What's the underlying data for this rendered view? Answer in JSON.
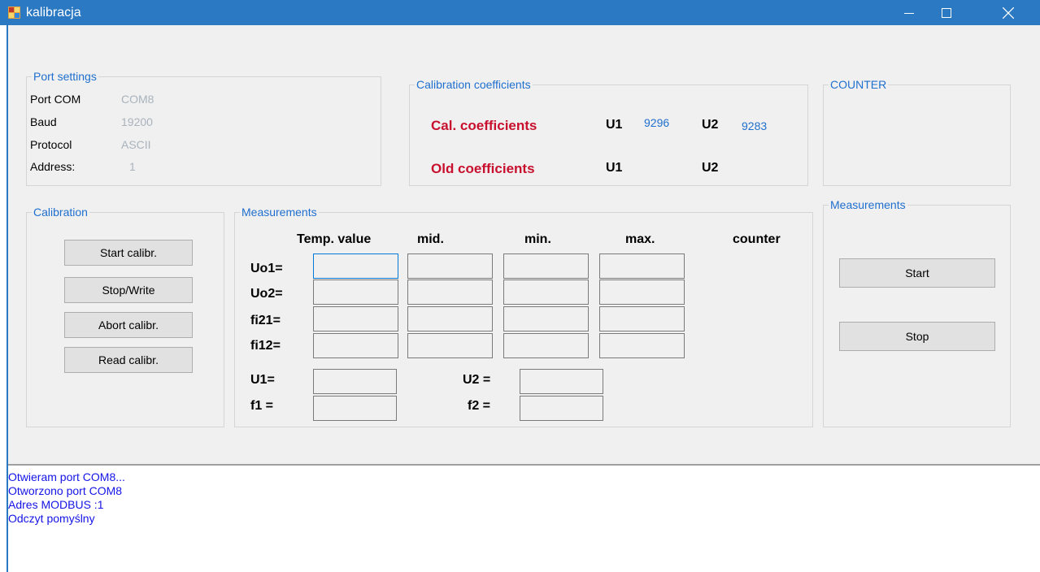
{
  "window": {
    "title": "kalibracja"
  },
  "port_settings": {
    "legend": "Port settings",
    "rows": [
      {
        "label": "Port COM",
        "value": "COM8"
      },
      {
        "label": "Baud",
        "value": "19200"
      },
      {
        "label": "Protocol",
        "value": "ASCII"
      },
      {
        "label": "Address:",
        "value": "1"
      }
    ]
  },
  "calibration_coefficients": {
    "legend": "Calibration coefficients",
    "cal_label": "Cal. coefficients",
    "old_label": "Old coefficients",
    "u1_label": "U1",
    "u2_label": "U2",
    "cal_u1_value": "9296",
    "cal_u2_value": "9283"
  },
  "counter_group": {
    "legend": "COUNTER"
  },
  "calibration": {
    "legend": "Calibration",
    "buttons": [
      "Start calibr.",
      "Stop/Write",
      "Abort calibr.",
      "Read calibr."
    ]
  },
  "measurements": {
    "legend": "Measurements",
    "headers": [
      "Temp. value",
      "mid.",
      "min.",
      "max.",
      "counter"
    ],
    "rows": [
      "Uo1=",
      "Uo2=",
      "fi21=",
      "fi12="
    ],
    "u1_label": "U1=",
    "f1_label": "f1 =",
    "u2_label": "U2 =",
    "f2_label": "f2 ="
  },
  "measurements_right": {
    "legend": "Measurements",
    "start_label": "Start",
    "stop_label": "Stop"
  },
  "log": {
    "lines": [
      "Otwieram port COM8...",
      "Otworzono port COM8",
      "Adres MODBUS :1",
      "Odczyt pomyślny"
    ]
  },
  "colors": {
    "titlebar": "#2b79c2",
    "legend": "#1f6fce",
    "red_label": "#c8102e",
    "log_text": "#1414e6",
    "value_grey": "#a9b3bd"
  }
}
